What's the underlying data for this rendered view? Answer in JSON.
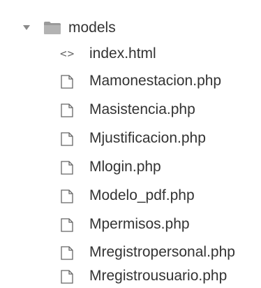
{
  "folder": {
    "name": "models",
    "expanded_icon": "chevron-down-icon",
    "icon": "folder-open-icon"
  },
  "files": [
    {
      "name": "index.html",
      "icon": "code-icon"
    },
    {
      "name": "Mamonestacion.php",
      "icon": "file-icon"
    },
    {
      "name": "Masistencia.php",
      "icon": "file-icon"
    },
    {
      "name": "Mjustificacion.php",
      "icon": "file-icon"
    },
    {
      "name": "Mlogin.php",
      "icon": "file-icon"
    },
    {
      "name": "Modelo_pdf.php",
      "icon": "file-icon"
    },
    {
      "name": "Mpermisos.php",
      "icon": "file-icon"
    },
    {
      "name": "Mregistropersonal.php",
      "icon": "file-icon"
    },
    {
      "name": "Mregistrousuario.php",
      "icon": "file-icon"
    }
  ],
  "colors": {
    "text": "#333333",
    "icon": "#666666",
    "chevron": "#8a8a8a",
    "folder_fill": "#9a9a9a"
  }
}
